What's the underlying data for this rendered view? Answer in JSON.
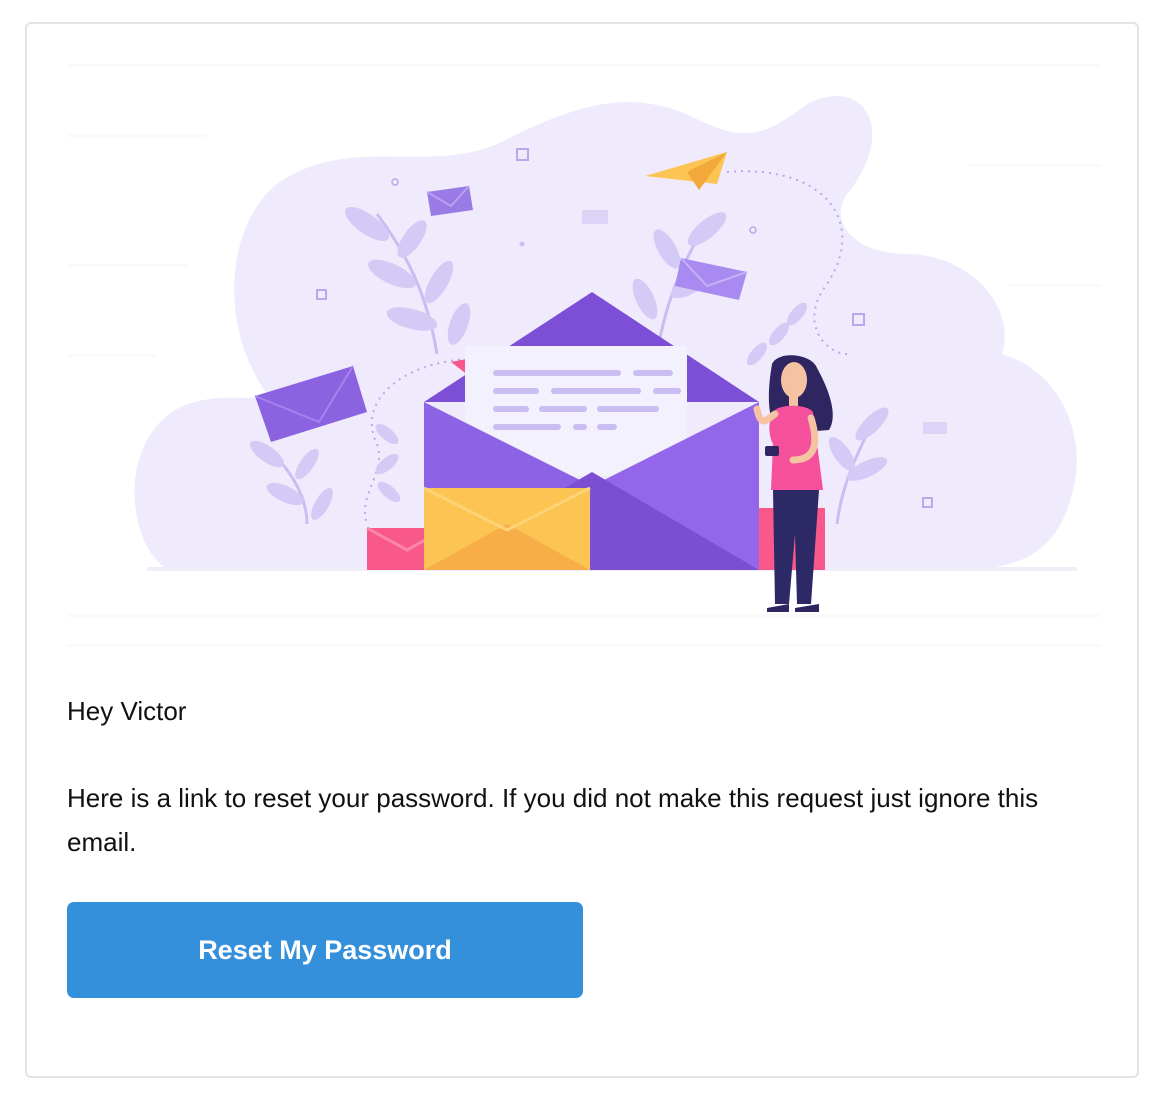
{
  "email": {
    "greeting": "Hey Victor",
    "message": "Here is a link to reset your password. If you did not make this request just ignore this email.",
    "button_label": "Reset My Password"
  },
  "theme": {
    "button_color": "#3590dc",
    "card_border": "#e3e3e6",
    "illustration_purple": "#7d4fd6",
    "illustration_yellow": "#fcc452",
    "illustration_pink": "#f8588a",
    "illustration_background": "#efebfc"
  },
  "hero": {
    "icon": "email-illustration"
  }
}
